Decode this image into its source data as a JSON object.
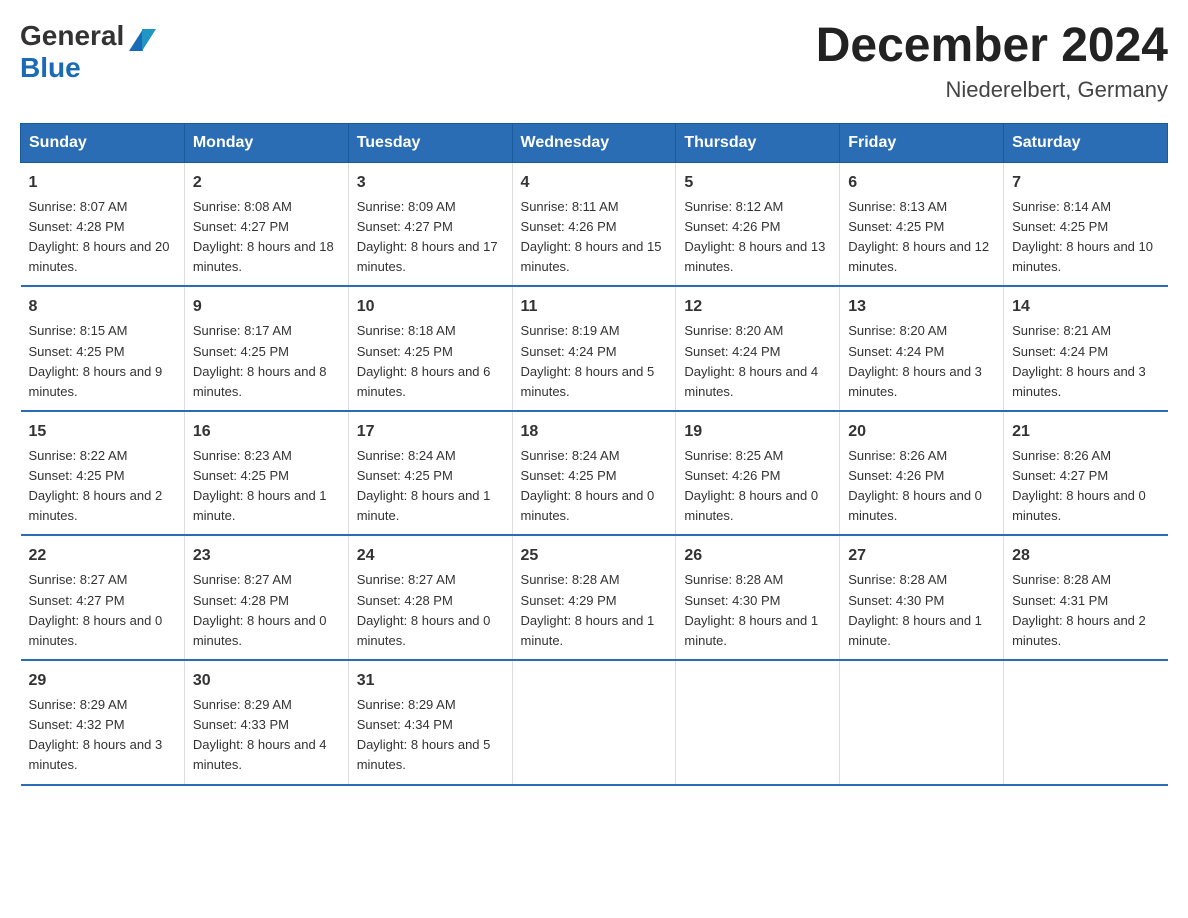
{
  "logo": {
    "general": "General",
    "blue": "Blue"
  },
  "title": "December 2024",
  "location": "Niederelbert, Germany",
  "weekdays": [
    "Sunday",
    "Monday",
    "Tuesday",
    "Wednesday",
    "Thursday",
    "Friday",
    "Saturday"
  ],
  "weeks": [
    [
      {
        "day": "1",
        "sunrise": "Sunrise: 8:07 AM",
        "sunset": "Sunset: 4:28 PM",
        "daylight": "Daylight: 8 hours and 20 minutes."
      },
      {
        "day": "2",
        "sunrise": "Sunrise: 8:08 AM",
        "sunset": "Sunset: 4:27 PM",
        "daylight": "Daylight: 8 hours and 18 minutes."
      },
      {
        "day": "3",
        "sunrise": "Sunrise: 8:09 AM",
        "sunset": "Sunset: 4:27 PM",
        "daylight": "Daylight: 8 hours and 17 minutes."
      },
      {
        "day": "4",
        "sunrise": "Sunrise: 8:11 AM",
        "sunset": "Sunset: 4:26 PM",
        "daylight": "Daylight: 8 hours and 15 minutes."
      },
      {
        "day": "5",
        "sunrise": "Sunrise: 8:12 AM",
        "sunset": "Sunset: 4:26 PM",
        "daylight": "Daylight: 8 hours and 13 minutes."
      },
      {
        "day": "6",
        "sunrise": "Sunrise: 8:13 AM",
        "sunset": "Sunset: 4:25 PM",
        "daylight": "Daylight: 8 hours and 12 minutes."
      },
      {
        "day": "7",
        "sunrise": "Sunrise: 8:14 AM",
        "sunset": "Sunset: 4:25 PM",
        "daylight": "Daylight: 8 hours and 10 minutes."
      }
    ],
    [
      {
        "day": "8",
        "sunrise": "Sunrise: 8:15 AM",
        "sunset": "Sunset: 4:25 PM",
        "daylight": "Daylight: 8 hours and 9 minutes."
      },
      {
        "day": "9",
        "sunrise": "Sunrise: 8:17 AM",
        "sunset": "Sunset: 4:25 PM",
        "daylight": "Daylight: 8 hours and 8 minutes."
      },
      {
        "day": "10",
        "sunrise": "Sunrise: 8:18 AM",
        "sunset": "Sunset: 4:25 PM",
        "daylight": "Daylight: 8 hours and 6 minutes."
      },
      {
        "day": "11",
        "sunrise": "Sunrise: 8:19 AM",
        "sunset": "Sunset: 4:24 PM",
        "daylight": "Daylight: 8 hours and 5 minutes."
      },
      {
        "day": "12",
        "sunrise": "Sunrise: 8:20 AM",
        "sunset": "Sunset: 4:24 PM",
        "daylight": "Daylight: 8 hours and 4 minutes."
      },
      {
        "day": "13",
        "sunrise": "Sunrise: 8:20 AM",
        "sunset": "Sunset: 4:24 PM",
        "daylight": "Daylight: 8 hours and 3 minutes."
      },
      {
        "day": "14",
        "sunrise": "Sunrise: 8:21 AM",
        "sunset": "Sunset: 4:24 PM",
        "daylight": "Daylight: 8 hours and 3 minutes."
      }
    ],
    [
      {
        "day": "15",
        "sunrise": "Sunrise: 8:22 AM",
        "sunset": "Sunset: 4:25 PM",
        "daylight": "Daylight: 8 hours and 2 minutes."
      },
      {
        "day": "16",
        "sunrise": "Sunrise: 8:23 AM",
        "sunset": "Sunset: 4:25 PM",
        "daylight": "Daylight: 8 hours and 1 minute."
      },
      {
        "day": "17",
        "sunrise": "Sunrise: 8:24 AM",
        "sunset": "Sunset: 4:25 PM",
        "daylight": "Daylight: 8 hours and 1 minute."
      },
      {
        "day": "18",
        "sunrise": "Sunrise: 8:24 AM",
        "sunset": "Sunset: 4:25 PM",
        "daylight": "Daylight: 8 hours and 0 minutes."
      },
      {
        "day": "19",
        "sunrise": "Sunrise: 8:25 AM",
        "sunset": "Sunset: 4:26 PM",
        "daylight": "Daylight: 8 hours and 0 minutes."
      },
      {
        "day": "20",
        "sunrise": "Sunrise: 8:26 AM",
        "sunset": "Sunset: 4:26 PM",
        "daylight": "Daylight: 8 hours and 0 minutes."
      },
      {
        "day": "21",
        "sunrise": "Sunrise: 8:26 AM",
        "sunset": "Sunset: 4:27 PM",
        "daylight": "Daylight: 8 hours and 0 minutes."
      }
    ],
    [
      {
        "day": "22",
        "sunrise": "Sunrise: 8:27 AM",
        "sunset": "Sunset: 4:27 PM",
        "daylight": "Daylight: 8 hours and 0 minutes."
      },
      {
        "day": "23",
        "sunrise": "Sunrise: 8:27 AM",
        "sunset": "Sunset: 4:28 PM",
        "daylight": "Daylight: 8 hours and 0 minutes."
      },
      {
        "day": "24",
        "sunrise": "Sunrise: 8:27 AM",
        "sunset": "Sunset: 4:28 PM",
        "daylight": "Daylight: 8 hours and 0 minutes."
      },
      {
        "day": "25",
        "sunrise": "Sunrise: 8:28 AM",
        "sunset": "Sunset: 4:29 PM",
        "daylight": "Daylight: 8 hours and 1 minute."
      },
      {
        "day": "26",
        "sunrise": "Sunrise: 8:28 AM",
        "sunset": "Sunset: 4:30 PM",
        "daylight": "Daylight: 8 hours and 1 minute."
      },
      {
        "day": "27",
        "sunrise": "Sunrise: 8:28 AM",
        "sunset": "Sunset: 4:30 PM",
        "daylight": "Daylight: 8 hours and 1 minute."
      },
      {
        "day": "28",
        "sunrise": "Sunrise: 8:28 AM",
        "sunset": "Sunset: 4:31 PM",
        "daylight": "Daylight: 8 hours and 2 minutes."
      }
    ],
    [
      {
        "day": "29",
        "sunrise": "Sunrise: 8:29 AM",
        "sunset": "Sunset: 4:32 PM",
        "daylight": "Daylight: 8 hours and 3 minutes."
      },
      {
        "day": "30",
        "sunrise": "Sunrise: 8:29 AM",
        "sunset": "Sunset: 4:33 PM",
        "daylight": "Daylight: 8 hours and 4 minutes."
      },
      {
        "day": "31",
        "sunrise": "Sunrise: 8:29 AM",
        "sunset": "Sunset: 4:34 PM",
        "daylight": "Daylight: 8 hours and 5 minutes."
      },
      null,
      null,
      null,
      null
    ]
  ]
}
